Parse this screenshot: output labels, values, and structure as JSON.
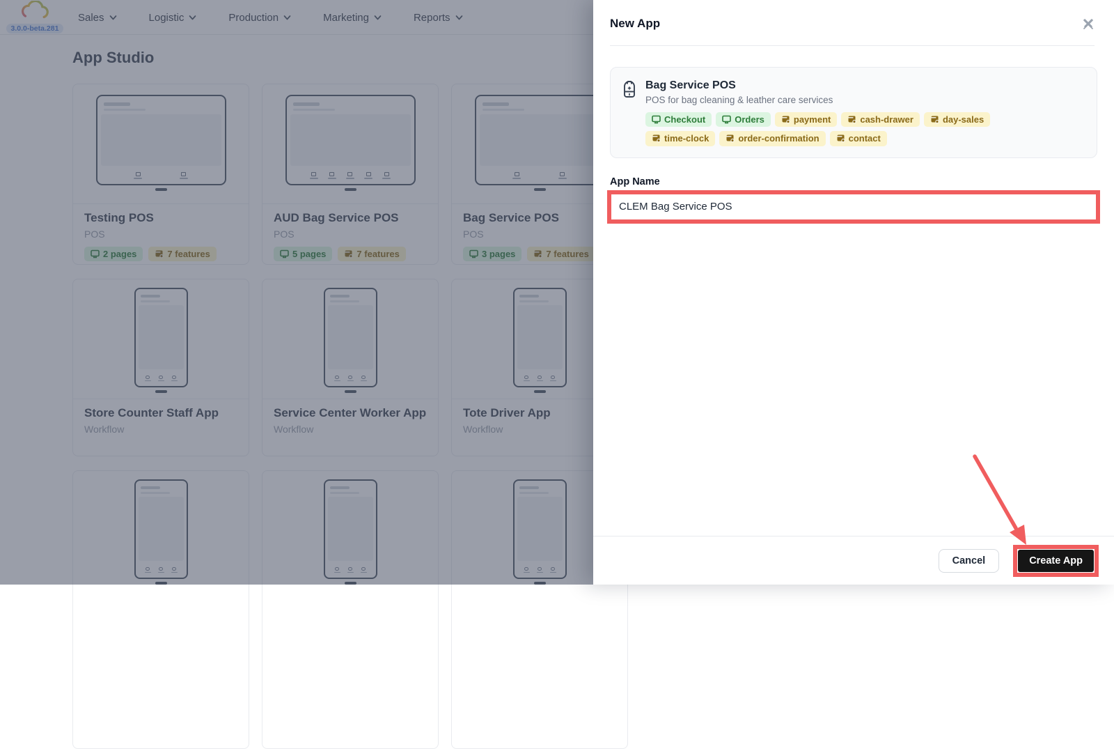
{
  "colors": {
    "annotation_red": "#F05D5E",
    "tag_green_bg": "#DCF5E1",
    "tag_green_text": "#2E7D3A",
    "tag_yellow_bg": "#FBF3CB",
    "tag_yellow_text": "#8A6A19",
    "badge_blue": "#4C7BD2"
  },
  "version_badge": "3.0.0-beta.281",
  "nav": {
    "items": [
      {
        "label": "Sales"
      },
      {
        "label": "Logistic"
      },
      {
        "label": "Production"
      },
      {
        "label": "Marketing"
      },
      {
        "label": "Reports"
      }
    ]
  },
  "app_studio": {
    "title": "App Studio",
    "cards": [
      {
        "title": "Testing POS",
        "type": "POS",
        "pages": "2 pages",
        "features": "7 features"
      },
      {
        "title": "AUD Bag Service POS",
        "type": "POS",
        "pages": "5 pages",
        "features": "7 features"
      },
      {
        "title": "Bag Service POS",
        "type": "POS",
        "pages": "3 pages",
        "features": "7 features"
      },
      {
        "title": "Store Counter Staff App",
        "type": "Workflow"
      },
      {
        "title": "Service Center Worker App",
        "type": "Workflow"
      },
      {
        "title": "Tote Driver App",
        "type": "Workflow"
      }
    ]
  },
  "drawer": {
    "title": "New App",
    "template_card": {
      "name": "Bag Service POS",
      "description": "POS for bag cleaning & leather care services",
      "tags": [
        {
          "label": "Checkout",
          "kind": "page"
        },
        {
          "label": "Orders",
          "kind": "page"
        },
        {
          "label": "payment",
          "kind": "feature"
        },
        {
          "label": "cash-drawer",
          "kind": "feature"
        },
        {
          "label": "day-sales",
          "kind": "feature"
        },
        {
          "label": "time-clock",
          "kind": "feature"
        },
        {
          "label": "order-confirmation",
          "kind": "feature"
        },
        {
          "label": "contact",
          "kind": "feature"
        }
      ]
    },
    "form": {
      "app_name_label": "App Name",
      "app_name_value": "CLEM Bag Service POS"
    },
    "footer": {
      "cancel_label": "Cancel",
      "create_label": "Create App"
    }
  }
}
